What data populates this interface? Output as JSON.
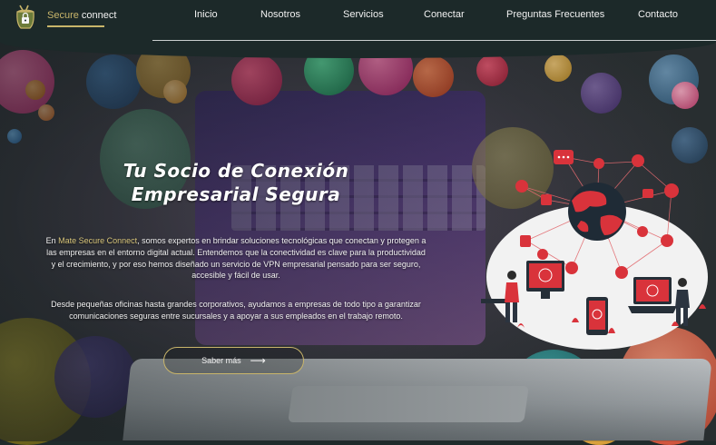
{
  "brand": {
    "word1": "Secure",
    "word2": "connect",
    "accent": "#c9b56a"
  },
  "nav": {
    "items": [
      "Inicio",
      "Nosotros",
      "Servicios",
      "Conectar",
      "Preguntas Frecuentes",
      "Contacto"
    ]
  },
  "hero": {
    "title_line1": "Tu Socio de Conexión",
    "title_line2": "Empresarial Segura",
    "p1_pre": "En ",
    "p1_highlight": "Mate Secure Connect",
    "p1_rest": ", somos expertos en brindar soluciones tecnológicas que conectan y protegen a las empresas en el entorno digital actual. Entendemos que la conectividad es clave para la productividad y el crecimiento, y por eso hemos diseñado un servicio de VPN empresarial pensado para ser seguro, accesible y fácil de usar.",
    "p2": "Desde pequeñas oficinas hasta grandes corporativos, ayudamos a empresas de todo tipo a garantizar comunicaciones seguras entre sucursales y a apoyar a sus empleados en el trabajo remoto.",
    "cta_label": "Saber más",
    "cta_icon": "arrow-right-icon"
  },
  "colors": {
    "header_bg": "#1c2929",
    "accent": "#c9b56a",
    "illustration_red": "#d9333b"
  }
}
